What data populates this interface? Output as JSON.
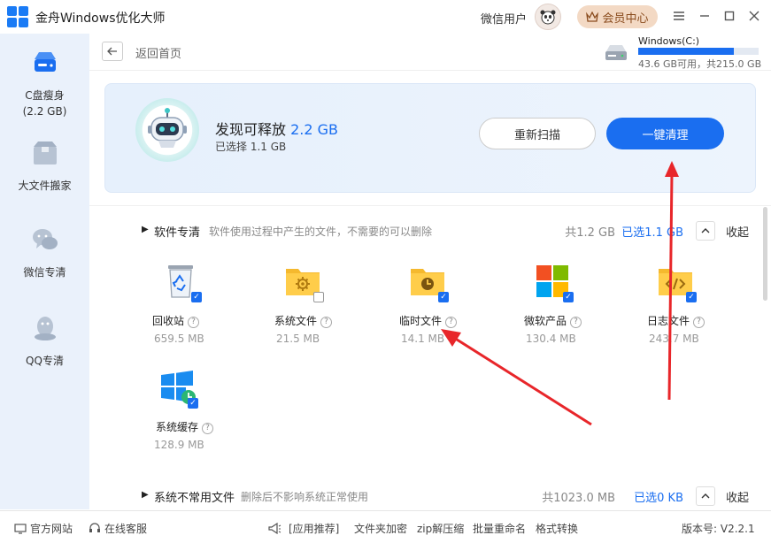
{
  "app": {
    "title": "金舟Windows优化大师",
    "user_name": "微信用户",
    "vip_label": "会员中心"
  },
  "sidebar": {
    "items": [
      {
        "label": "C盘瘦身",
        "sub": "(2.2 GB)"
      },
      {
        "label": "大文件搬家"
      },
      {
        "label": "微信专清"
      },
      {
        "label": "QQ专清"
      }
    ]
  },
  "topbar": {
    "back_label": "返回首页",
    "disk_name": "Windows(C:)",
    "disk_info": "43.6 GB可用，共215.0 GB",
    "disk_used_fraction": 0.7972
  },
  "result": {
    "found_prefix": "发现可释放",
    "found_size": "2.2 GB",
    "selected": "已选择 1.1 GB",
    "rescan_label": "重新扫描",
    "clean_label": "一键清理"
  },
  "sections": [
    {
      "title": "软件专清",
      "desc": "软件使用过程中产生的文件，不需要的可以删除",
      "total": "共1.2 GB",
      "selected": "已选1.1 GB",
      "collapse_label": "收起",
      "items": [
        {
          "name": "回收站",
          "size": "659.5 MB",
          "checked": true,
          "icon": "recycle-bin-icon"
        },
        {
          "name": "系统文件",
          "size": "21.5 MB",
          "checked": false,
          "icon": "system-folder-icon"
        },
        {
          "name": "临时文件",
          "size": "14.1 MB",
          "checked": true,
          "icon": "temp-folder-icon"
        },
        {
          "name": "微软产品",
          "size": "130.4 MB",
          "checked": true,
          "icon": "microsoft-icon"
        },
        {
          "name": "日志文件",
          "size": "243.7 MB",
          "checked": true,
          "icon": "log-folder-icon"
        },
        {
          "name": "系统缓存",
          "size": "128.9 MB",
          "checked": true,
          "icon": "windows-cache-icon"
        }
      ]
    },
    {
      "title": "系统不常用文件",
      "desc": "删除后不影响系统正常使用",
      "total": "共1023.0 MB",
      "selected": "已选0 KB",
      "collapse_label": "收起"
    }
  ],
  "footer": {
    "website": "官方网站",
    "service": "在线客服",
    "recommend": "[应用推荐]",
    "links": [
      "文件夹加密",
      "zip解压缩",
      "批量重命名",
      "格式转换"
    ],
    "version": "版本号: V2.2.1"
  },
  "colors": {
    "accent": "#1a6ef0",
    "sidebar_bg": "#eaf1fb",
    "annotation_arrow": "#e8262a"
  }
}
